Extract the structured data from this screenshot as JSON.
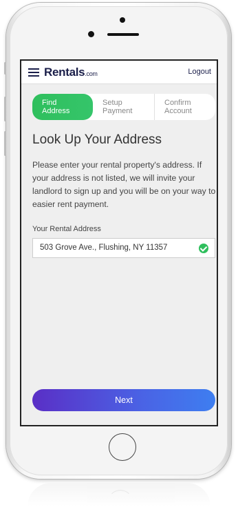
{
  "header": {
    "logo_main": "Rentals",
    "logo_suffix": ".com",
    "logout_label": "Logout",
    "menu_icon": "hamburger-menu-icon"
  },
  "steps": [
    {
      "line1": "Find",
      "line2": "Address",
      "active": true
    },
    {
      "line1": "Setup",
      "line2": "Payment",
      "active": false
    },
    {
      "line1": "Confirm",
      "line2": "Account",
      "active": false
    }
  ],
  "main": {
    "title": "Look Up Your Address",
    "description": "Please enter your rental property's address. If your address is not listed, we will invite your landlord to sign up and you will be on your way to easier rent payment.",
    "address_label": "Your Rental Address",
    "address_value": "503 Grove Ave., Flushing, NY 11357",
    "address_status_icon": "check-circle-icon"
  },
  "footer": {
    "next_label": "Next"
  },
  "colors": {
    "brand_navy": "#1b1f4a",
    "active_step_green": "#2fbf5d",
    "button_gradient_start": "#5a2fc6",
    "button_gradient_end": "#3e7ef0"
  }
}
